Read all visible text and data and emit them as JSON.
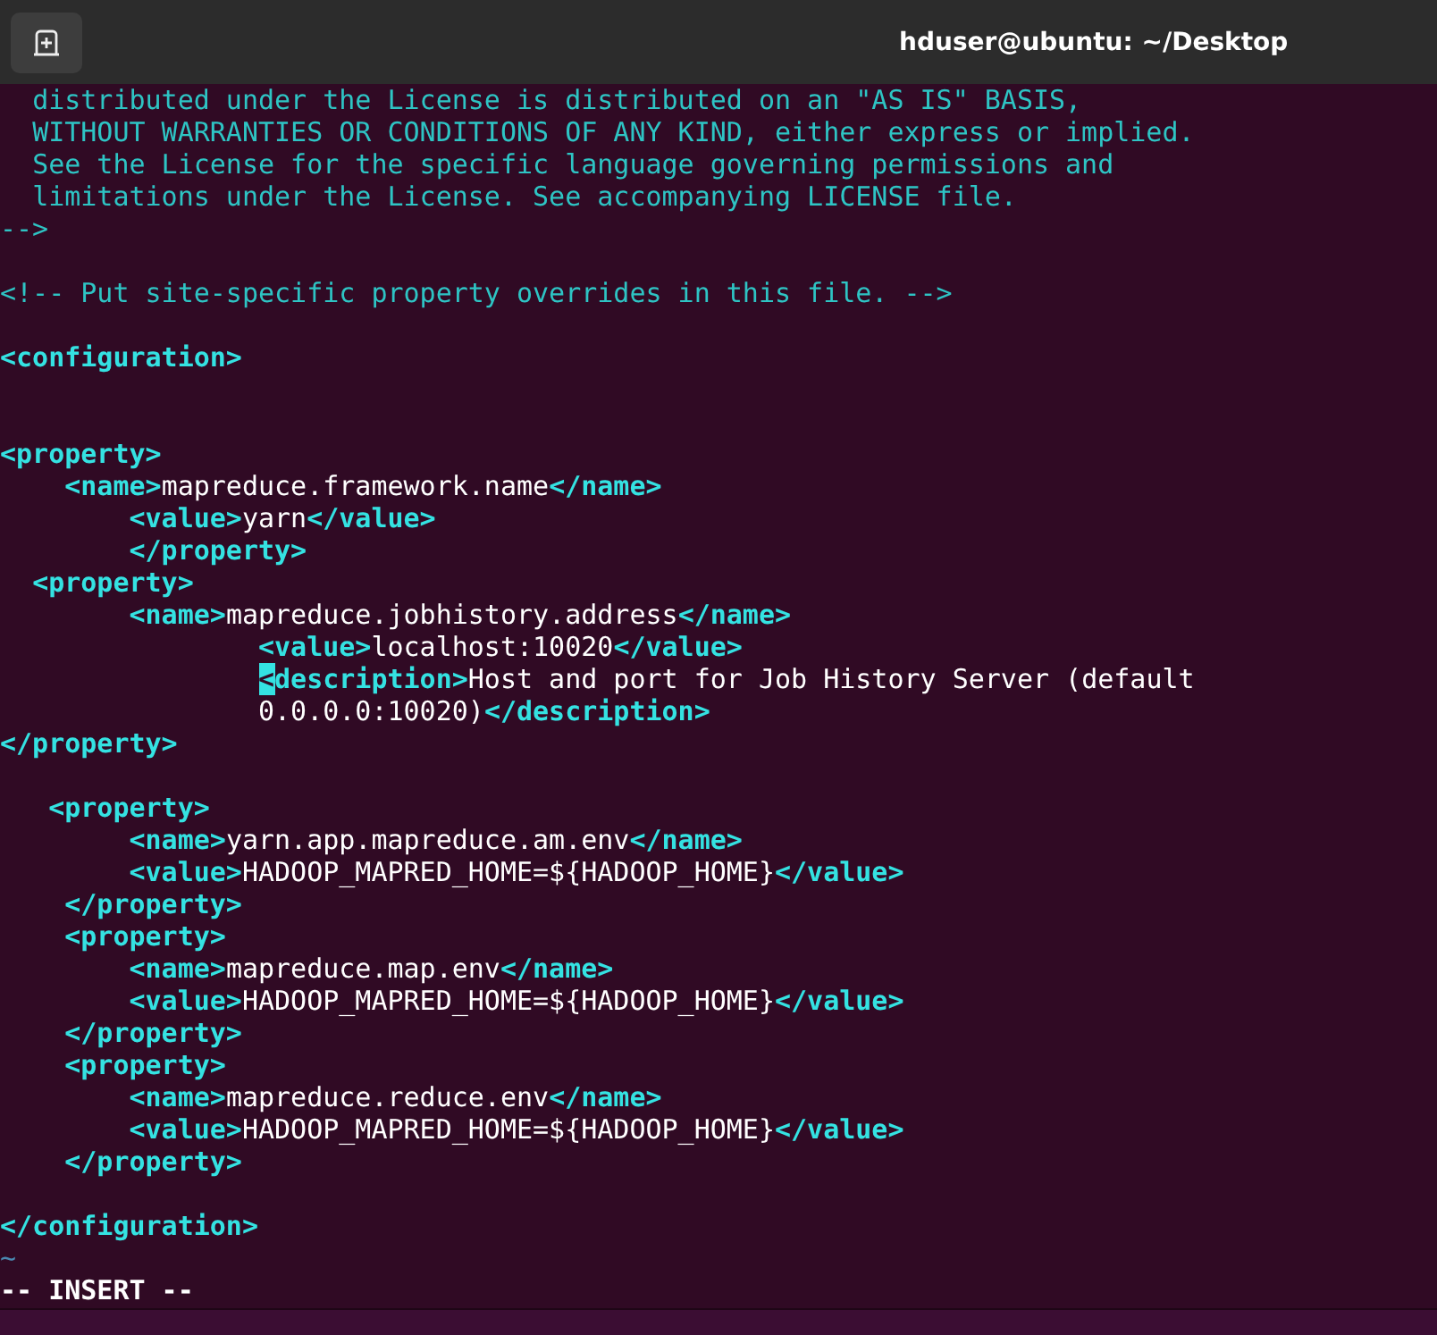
{
  "window": {
    "title": "hduser@ubuntu: ~/Desktop"
  },
  "editor": {
    "lines": [
      {
        "kind": "code",
        "segments": [
          {
            "kind": "comment",
            "text": "  distributed under the License is distributed on an \"AS IS\" BASIS,"
          }
        ]
      },
      {
        "kind": "code",
        "segments": [
          {
            "kind": "comment",
            "text": "  WITHOUT WARRANTIES OR CONDITIONS OF ANY KIND, either express or implied."
          }
        ]
      },
      {
        "kind": "code",
        "segments": [
          {
            "kind": "comment",
            "text": "  See the License for the specific language governing permissions and"
          }
        ]
      },
      {
        "kind": "code",
        "segments": [
          {
            "kind": "comment",
            "text": "  limitations under the License. See accompanying LICENSE file."
          }
        ]
      },
      {
        "kind": "code",
        "segments": [
          {
            "kind": "comment",
            "text": "-->"
          }
        ]
      },
      {
        "kind": "blank"
      },
      {
        "kind": "code",
        "segments": [
          {
            "kind": "comment",
            "text": "<!-- Put site-specific property overrides in this file. -->"
          }
        ]
      },
      {
        "kind": "blank"
      },
      {
        "kind": "code",
        "segments": [
          {
            "kind": "tag",
            "text": "<configuration>"
          }
        ]
      },
      {
        "kind": "blank"
      },
      {
        "kind": "blank"
      },
      {
        "kind": "code",
        "segments": [
          {
            "kind": "tag",
            "text": "<property>"
          }
        ]
      },
      {
        "kind": "code",
        "segments": [
          {
            "kind": "tag",
            "text": "    <name>"
          },
          {
            "kind": "text",
            "text": "mapreduce.framework.name"
          },
          {
            "kind": "tag",
            "text": "</name>"
          }
        ]
      },
      {
        "kind": "code",
        "segments": [
          {
            "kind": "tag",
            "text": "        <value>"
          },
          {
            "kind": "text",
            "text": "yarn"
          },
          {
            "kind": "tag",
            "text": "</value>"
          }
        ]
      },
      {
        "kind": "code",
        "segments": [
          {
            "kind": "tag",
            "text": "        </property>"
          }
        ]
      },
      {
        "kind": "code",
        "segments": [
          {
            "kind": "tag",
            "text": "  <property>"
          }
        ]
      },
      {
        "kind": "code",
        "segments": [
          {
            "kind": "tag",
            "text": "        <name>"
          },
          {
            "kind": "text",
            "text": "mapreduce.jobhistory.address"
          },
          {
            "kind": "tag",
            "text": "</name>"
          }
        ]
      },
      {
        "kind": "code",
        "segments": [
          {
            "kind": "tag",
            "text": "                <value>"
          },
          {
            "kind": "text",
            "text": "localhost:10020"
          },
          {
            "kind": "tag",
            "text": "</value>"
          }
        ]
      },
      {
        "kind": "code",
        "segments": [
          {
            "kind": "cursor",
            "text": "                <"
          },
          {
            "kind": "tag",
            "text": "description>"
          },
          {
            "kind": "text",
            "text": "Host and port for Job History Server (default"
          }
        ]
      },
      {
        "kind": "code",
        "segments": [
          {
            "kind": "text",
            "text": "                0.0.0.0:10020)"
          },
          {
            "kind": "tag",
            "text": "</description>"
          }
        ]
      },
      {
        "kind": "code",
        "segments": [
          {
            "kind": "tag",
            "text": "</property>"
          }
        ]
      },
      {
        "kind": "blank"
      },
      {
        "kind": "code",
        "segments": [
          {
            "kind": "tag",
            "text": "   <property>"
          }
        ]
      },
      {
        "kind": "code",
        "segments": [
          {
            "kind": "tag",
            "text": "        <name>"
          },
          {
            "kind": "text",
            "text": "yarn.app.mapreduce.am.env"
          },
          {
            "kind": "tag",
            "text": "</name>"
          }
        ]
      },
      {
        "kind": "code",
        "segments": [
          {
            "kind": "tag",
            "text": "        <value>"
          },
          {
            "kind": "text",
            "text": "HADOOP_MAPRED_HOME=${HADOOP_HOME}"
          },
          {
            "kind": "tag",
            "text": "</value>"
          }
        ]
      },
      {
        "kind": "code",
        "segments": [
          {
            "kind": "tag",
            "text": "    </property>"
          }
        ]
      },
      {
        "kind": "code",
        "segments": [
          {
            "kind": "tag",
            "text": "    <property>"
          }
        ]
      },
      {
        "kind": "code",
        "segments": [
          {
            "kind": "tag",
            "text": "        <name>"
          },
          {
            "kind": "text",
            "text": "mapreduce.map.env"
          },
          {
            "kind": "tag",
            "text": "</name>"
          }
        ]
      },
      {
        "kind": "code",
        "segments": [
          {
            "kind": "tag",
            "text": "        <value>"
          },
          {
            "kind": "text",
            "text": "HADOOP_MAPRED_HOME=${HADOOP_HOME}"
          },
          {
            "kind": "tag",
            "text": "</value>"
          }
        ]
      },
      {
        "kind": "code",
        "segments": [
          {
            "kind": "tag",
            "text": "    </property>"
          }
        ]
      },
      {
        "kind": "code",
        "segments": [
          {
            "kind": "tag",
            "text": "    <property>"
          }
        ]
      },
      {
        "kind": "code",
        "segments": [
          {
            "kind": "tag",
            "text": "        <name>"
          },
          {
            "kind": "text",
            "text": "mapreduce.reduce.env"
          },
          {
            "kind": "tag",
            "text": "</name>"
          }
        ]
      },
      {
        "kind": "code",
        "segments": [
          {
            "kind": "tag",
            "text": "        <value>"
          },
          {
            "kind": "text",
            "text": "HADOOP_MAPRED_HOME=${HADOOP_HOME}"
          },
          {
            "kind": "tag",
            "text": "</value>"
          }
        ]
      },
      {
        "kind": "code",
        "segments": [
          {
            "kind": "tag",
            "text": "    </property>"
          }
        ]
      },
      {
        "kind": "blank"
      },
      {
        "kind": "code",
        "segments": [
          {
            "kind": "tag",
            "text": "</configuration>"
          }
        ]
      },
      {
        "kind": "code",
        "segments": [
          {
            "kind": "tilde",
            "text": "~"
          }
        ]
      }
    ],
    "mode": "-- INSERT --"
  }
}
